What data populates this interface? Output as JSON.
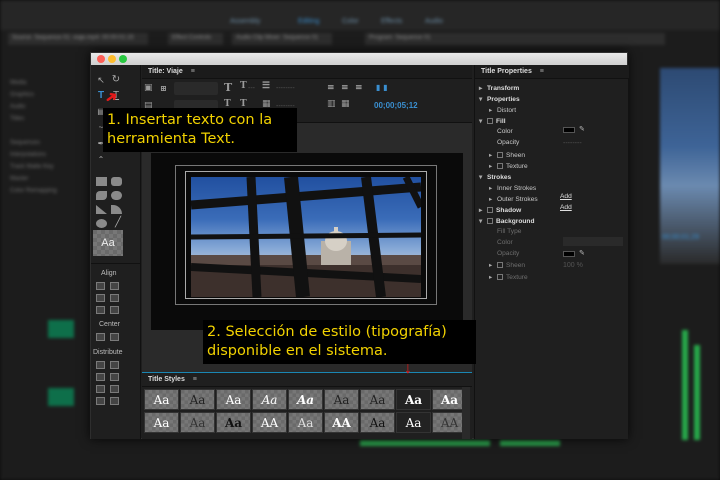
{
  "background_app": {
    "workspaces": [
      "Assembly",
      "Editing",
      "Color",
      "Effects",
      "Audio"
    ],
    "active_workspace": "Editing",
    "tabs": [
      "Source: Sequence 01: viaje.mp4: 00:00:01:15",
      "Effect Controls",
      "Audio Clip Mixer: Sequence 01",
      "Program: Sequence 01"
    ],
    "project_items": [
      "Media",
      "Graphics",
      "Audio",
      "Titles",
      "Sequences",
      "Interpolations",
      "Track Matte Key",
      "Master",
      "Color Remapping"
    ],
    "timecode_right": "00;00;01;29"
  },
  "window": {
    "title_panel_label": "Title: Viaje",
    "menu_icon": "≡"
  },
  "tools": {
    "active_tool": "type-tool",
    "aa_label": "Aa",
    "align_label": "Align",
    "center_label": "Center",
    "distribute_label": "Distribute"
  },
  "toolbar": {
    "timecode": "00;00;05;12"
  },
  "styles_panel": {
    "title": "Title Styles",
    "tile_label": "Aa",
    "row1": [
      "Aa",
      "Aa",
      "Aa",
      "Aa",
      "Aa",
      "Aa",
      "Aa",
      "Aa",
      "Aa"
    ],
    "row2": [
      "Aa",
      "Aa",
      "Aa",
      "AA",
      "Aa",
      "AA",
      "Aa",
      "Aa",
      "AA"
    ]
  },
  "properties": {
    "title": "Title Properties",
    "rows": [
      {
        "label": "Transform",
        "indent": 0,
        "bold": true,
        "tri": "▸"
      },
      {
        "label": "Properties",
        "indent": 0,
        "bold": true,
        "tri": "▾"
      },
      {
        "label": "Distort",
        "indent": 1,
        "bold": false,
        "tri": "▸"
      },
      {
        "label": "Fill",
        "indent": 0,
        "bold": true,
        "tri": "▾",
        "check": true
      },
      {
        "label": "Color",
        "indent": 1,
        "bold": false,
        "tri": ""
      },
      {
        "label": "Opacity",
        "indent": 1,
        "bold": false,
        "tri": ""
      },
      {
        "label": "Sheen",
        "indent": 1,
        "bold": false,
        "tri": "▸",
        "check": true
      },
      {
        "label": "Texture",
        "indent": 1,
        "bold": false,
        "tri": "▸",
        "check": true
      },
      {
        "label": "Strokes",
        "indent": 0,
        "bold": true,
        "tri": "▾"
      },
      {
        "label": "Inner Strokes",
        "indent": 1,
        "bold": false,
        "tri": "▸",
        "add": true
      },
      {
        "label": "Outer Strokes",
        "indent": 1,
        "bold": false,
        "tri": "▸",
        "add": true
      },
      {
        "label": "Shadow",
        "indent": 0,
        "bold": true,
        "tri": "▸",
        "check": true
      },
      {
        "label": "Background",
        "indent": 0,
        "bold": true,
        "tri": "▾",
        "check": true
      },
      {
        "label": "Fill Type",
        "indent": 1,
        "bold": false,
        "tri": "",
        "dim": true
      },
      {
        "label": "Color",
        "indent": 1,
        "bold": false,
        "tri": "",
        "dim": true
      },
      {
        "label": "Opacity",
        "indent": 1,
        "bold": false,
        "tri": "",
        "dim": true
      },
      {
        "label": "Sheen",
        "indent": 1,
        "bold": false,
        "tri": "▸",
        "dim": true,
        "check": true
      },
      {
        "label": "Texture",
        "indent": 1,
        "bold": false,
        "tri": "▸",
        "dim": true,
        "check": true
      }
    ],
    "add_label": "Add",
    "opacity_value_dim": "100 %"
  },
  "callouts": {
    "first_line1": "1. Insertar texto con la",
    "first_line2": "herramienta Text.",
    "second_line1": "2. Selección de estilo (tipografía)",
    "second_line2": "disponible en el sistema."
  }
}
